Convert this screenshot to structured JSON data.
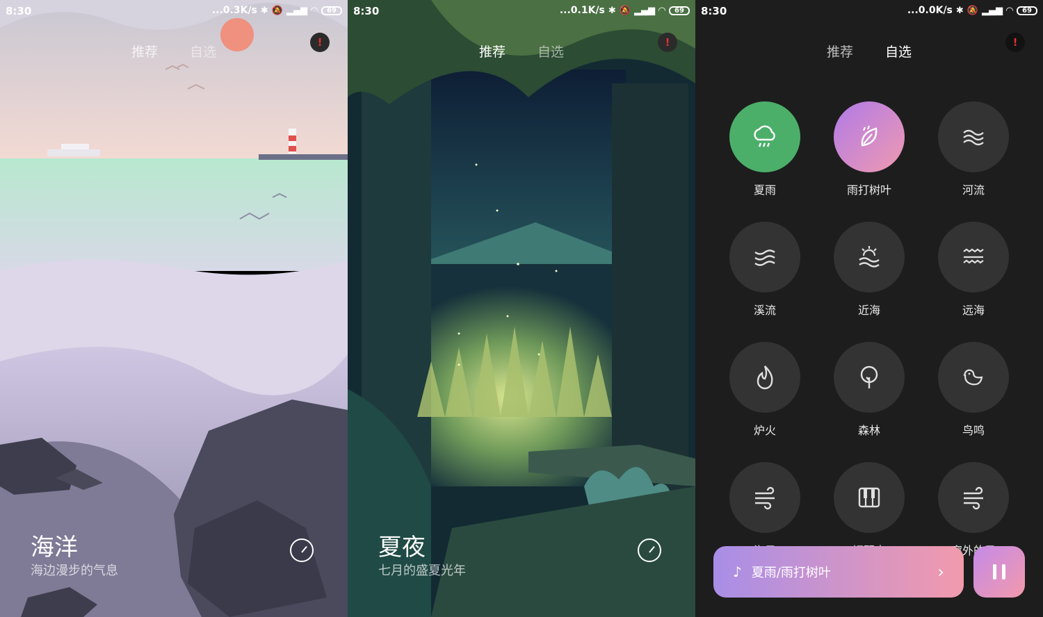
{
  "status_bar": {
    "time": "8:30",
    "battery": "69",
    "speeds": [
      "...0.3K/s",
      "...0.1K/s",
      "...0.0K/s"
    ]
  },
  "tabs": {
    "recommend": "推荐",
    "custom": "自选"
  },
  "alert_icon": "!",
  "screens": [
    {
      "title": "海洋",
      "subtitle": "海边漫步的气息"
    },
    {
      "title": "夏夜",
      "subtitle": "七月的盛夏光年"
    }
  ],
  "sounds": [
    {
      "label": "夏雨",
      "icon": "rain-cloud-icon",
      "color": "#4caf69"
    },
    {
      "label": "雨打树叶",
      "icon": "rain-leaf-icon",
      "color": "#c68ae0"
    },
    {
      "label": "河流",
      "icon": "river-icon"
    },
    {
      "label": "溪流",
      "icon": "stream-icon"
    },
    {
      "label": "近海",
      "icon": "near-sea-icon"
    },
    {
      "label": "远海",
      "icon": "far-sea-icon"
    },
    {
      "label": "炉火",
      "icon": "fire-icon"
    },
    {
      "label": "森林",
      "icon": "tree-icon"
    },
    {
      "label": "鸟鸣",
      "icon": "bird-icon"
    },
    {
      "label": "海风",
      "icon": "wind-icon"
    },
    {
      "label": "钢琴声",
      "icon": "piano-icon"
    },
    {
      "label": "窗外的风",
      "icon": "wind-window-icon"
    }
  ],
  "player": {
    "now_playing": "夏雨/雨打树叶"
  },
  "colors": {
    "accent_green": "#4caf69",
    "accent_purple": "#c68ae0",
    "player_gradient_start": "#a88ee8",
    "player_gradient_end": "#f29aac",
    "dark_bg": "#1d1d1d"
  }
}
